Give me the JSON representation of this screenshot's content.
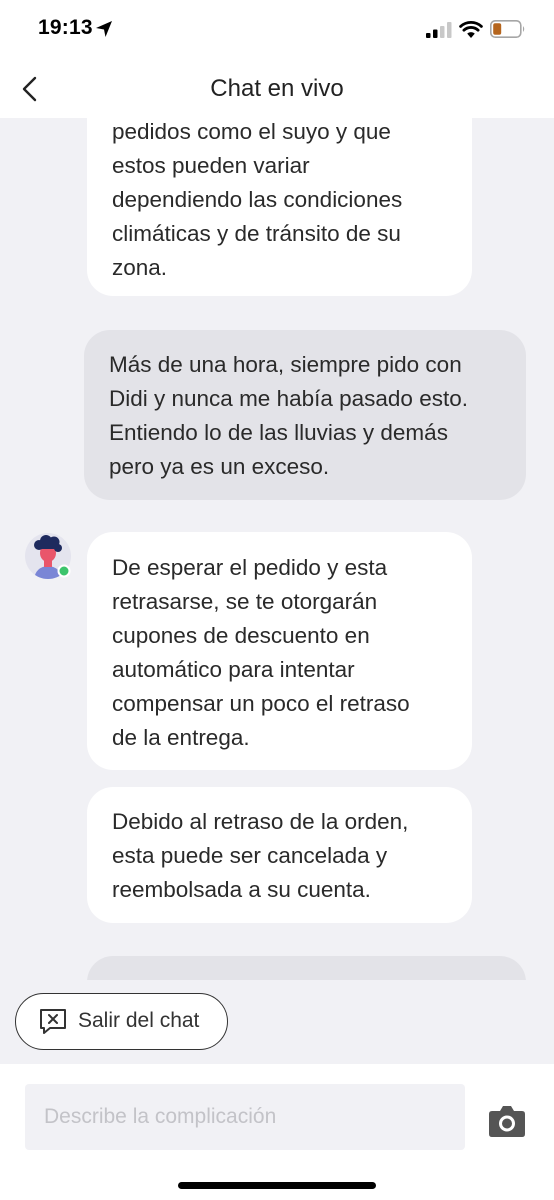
{
  "status_bar": {
    "time": "19:13",
    "icons": [
      "location-arrow-icon",
      "cellular-signal-icon",
      "wifi-icon",
      "battery-icon"
    ],
    "battery_color": "#b5651d"
  },
  "nav": {
    "title": "Chat en vivo",
    "back_icon": "chevron-left-icon"
  },
  "messages": [
    {
      "sender": "agent",
      "text": "pedidos como el suyo y que\nestos pueden variar\ndependiendo las condiciones\nclimáticas y de tránsito de su\nzona."
    },
    {
      "sender": "user",
      "text": "Más de una hora, siempre pido con\nDidi y nunca me había pasado esto.\nEntiendo lo de las lluvias y demás\npero ya es un exceso."
    },
    {
      "sender": "agent",
      "avatar_icon": "agent-avatar-icon",
      "online": true,
      "text": "De esperar el pedido y esta\nretrasarse, se te otorgarán\ncupones de descuento en\nautomático para intentar\ncompensar un poco el retraso\nde la entrega."
    },
    {
      "sender": "agent",
      "text": "Debido al retraso de la orden,\nesta puede ser cancelada y\nreembolsada a su cuenta."
    },
    {
      "sender": "user",
      "text": ""
    }
  ],
  "exit_chat": {
    "label": "Salir del chat",
    "icon": "close-chat-icon"
  },
  "composer": {
    "placeholder": "Describe la complicación",
    "value": "",
    "camera_icon": "camera-icon"
  },
  "colors": {
    "background": "#f1f1f5",
    "agent_bubble": "#ffffff",
    "user_bubble": "#e3e3e8",
    "online_dot": "#3cc46c"
  }
}
